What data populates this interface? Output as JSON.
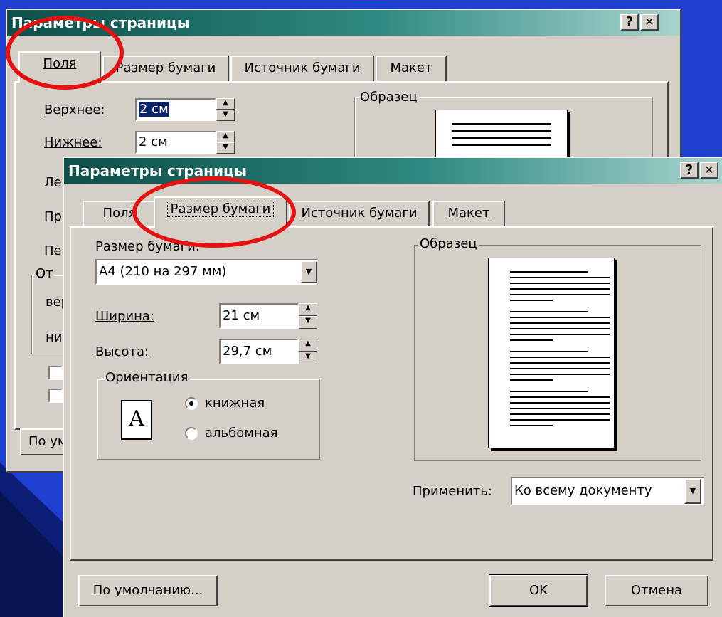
{
  "back_dialog": {
    "title": "Параметры страницы",
    "help_btn": "?",
    "close_btn": "✕",
    "tabs": [
      "Поля",
      "Размер бумаги",
      "Источник бумаги",
      "Макет"
    ],
    "top_label": "Верхнее:",
    "top_value": "2 см",
    "bottom_label": "Нижнее:",
    "bottom_value": "2 см",
    "left_partial": "Ле",
    "right_partial": "Пр",
    "gutter_partial": "Пе",
    "group_partial": "От",
    "group_row1_partial": "вер",
    "group_row2_partial": "ниж",
    "sample_title": "Образец",
    "default_btn_partial": "По ум"
  },
  "front_dialog": {
    "title": "Параметры страницы",
    "help_btn": "?",
    "close_btn": "✕",
    "tabs": [
      "Поля",
      "Размер бумаги",
      "Источник бумаги",
      "Макет"
    ],
    "paper_size_label": "Размер бумаги:",
    "paper_size_value": "A4 (210 на 297 мм)",
    "width_label": "Ширина:",
    "width_value": "21 см",
    "height_label": "Высота:",
    "height_value": "29,7 см",
    "orientation_title": "Ориентация",
    "orientation_icon_letter": "A",
    "portrait_label": "книжная",
    "landscape_label": "альбомная",
    "sample_title": "Образец",
    "apply_label": "Применить:",
    "apply_value": "Ко всему документу",
    "default_btn": "По умолчанию...",
    "ok_btn": "OK",
    "cancel_btn": "Отмена"
  },
  "colors": {
    "desktop": "#1f3fd0",
    "highlight_oval": "#e41212",
    "title_gradient_start": "#0d4f49"
  }
}
